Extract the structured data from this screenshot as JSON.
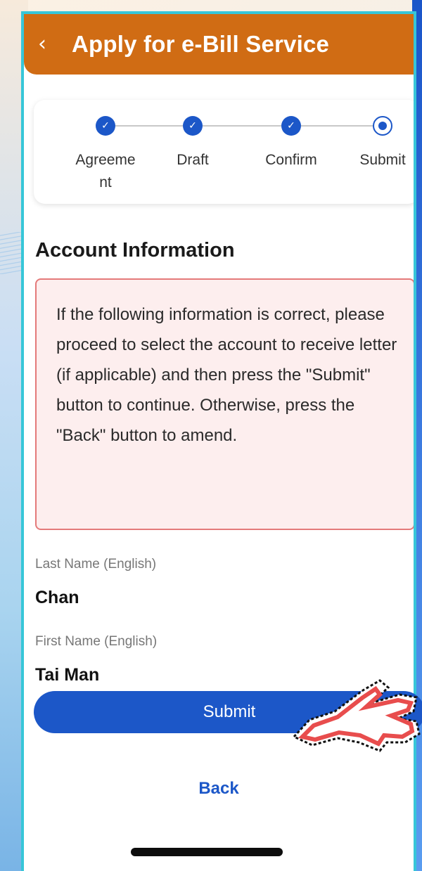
{
  "header": {
    "back_icon": "chevron-left-icon",
    "back_glyph": "‹",
    "title": "Apply for e-Bill Service",
    "color": "#d06c14"
  },
  "steps": [
    {
      "label": "Agreement",
      "state": "done"
    },
    {
      "label": "Draft",
      "state": "done"
    },
    {
      "label": "Confirm",
      "state": "done"
    },
    {
      "label": "Submit",
      "state": "current"
    }
  ],
  "section_title": "Account Information",
  "notice": {
    "text": "If the following information is correct, please proceed to select the account to receive letter (if applicable) and then press the \"Submit\" button to continue. Otherwise, press the \"Back\" button to amend.",
    "border_color": "#e47a7a",
    "background": "#fdeeee"
  },
  "fields": [
    {
      "label": "Last Name (English)",
      "value": "Chan"
    },
    {
      "label": "First Name (English)",
      "value": "Tai Man"
    }
  ],
  "actions": {
    "submit_label": "Submit",
    "back_label": "Back",
    "accent_color": "#1c57c8"
  },
  "cursor_icon": "hand-pointer-icon"
}
